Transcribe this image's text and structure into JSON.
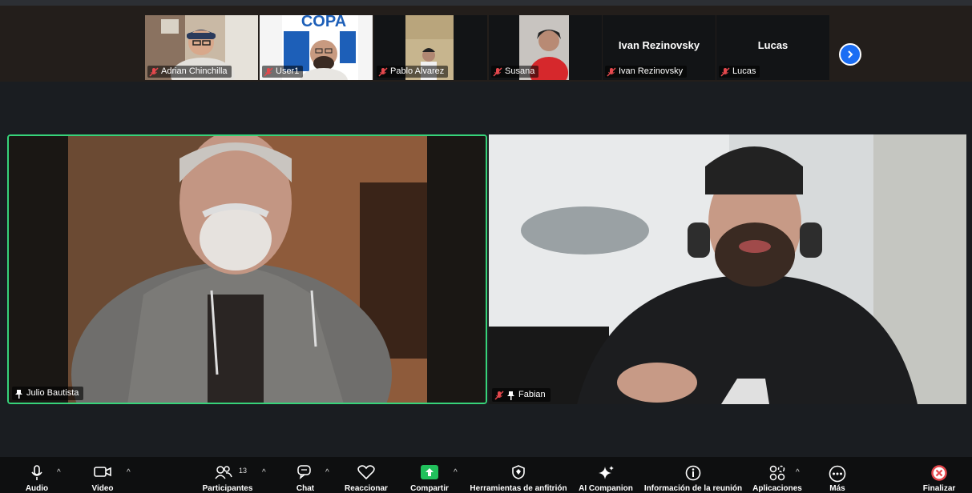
{
  "gallery": {
    "participants": [
      {
        "name": "Adrian Chinchilla",
        "muted": true
      },
      {
        "name": "User1",
        "muted": true
      },
      {
        "name": "Pablo Alvarez",
        "muted": true
      },
      {
        "name": "Susana",
        "muted": true
      },
      {
        "name": "Ivan Rezinovsky",
        "display_name": "Ivan Rezinovsky",
        "muted": true
      },
      {
        "name": "Lucas",
        "display_name": "Lucas",
        "muted": true
      }
    ],
    "logo_text": "COPA"
  },
  "main": {
    "left_speaker": {
      "name": "Julio Bautista",
      "pinned": true,
      "active_border_color": "#37d37a"
    },
    "right_speaker": {
      "name": "Fabian",
      "pinned": true,
      "muted": true
    }
  },
  "toolbar": {
    "audio": "Audio",
    "video": "Video",
    "participants": "Participantes",
    "participants_count": "13",
    "chat": "Chat",
    "react": "Reaccionar",
    "share": "Compartir",
    "host_tools": "Herramientas de anfitrión",
    "ai_companion": "AI Companion",
    "meeting_info": "Información de la reunión",
    "apps": "Aplicaciones",
    "more": "Más",
    "end": "Finalizar"
  },
  "colors": {
    "share_green": "#21c05c",
    "end_red": "#e5484d",
    "next_blue": "#1a6df4",
    "mic_off_red": "#e5484d"
  }
}
